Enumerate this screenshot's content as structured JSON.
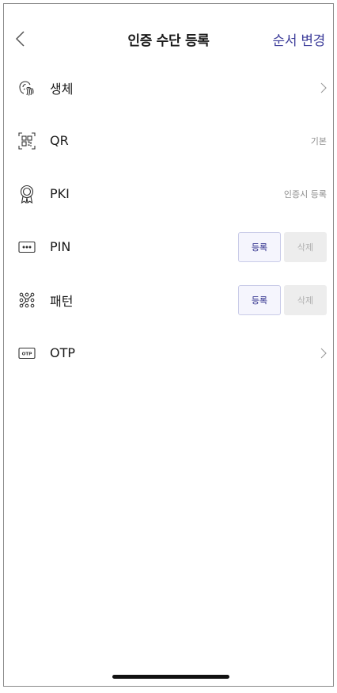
{
  "header": {
    "title": "인증 수단 등록",
    "action": "순서 변경"
  },
  "methods": [
    {
      "label": "생체",
      "icon": "fingerprint-face-icon"
    },
    {
      "label": "QR",
      "icon": "qr-code-icon",
      "status": "기본"
    },
    {
      "label": "PKI",
      "icon": "certificate-badge-icon",
      "status": "인증시 등록"
    },
    {
      "label": "PIN",
      "icon": "pin-dots-icon",
      "register": "등록",
      "delete": "삭제"
    },
    {
      "label": "패턴",
      "icon": "pattern-grid-icon",
      "register": "등록",
      "delete": "삭제"
    },
    {
      "label": "OTP",
      "icon": "otp-icon",
      "otp_text": "OTP"
    }
  ],
  "colors": {
    "accent": "#3d3d9a",
    "register_text": "#2b2b8a",
    "disabled": "#b0b0b0"
  }
}
